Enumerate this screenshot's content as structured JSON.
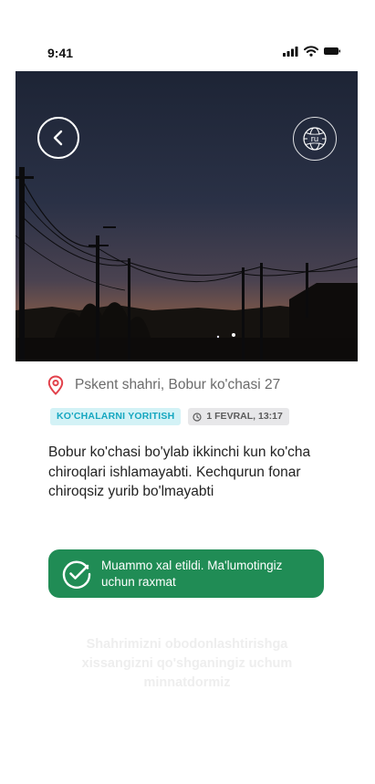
{
  "status_bar": {
    "time": "9:41",
    "icons": [
      "signal-icon",
      "wifi-icon",
      "battery-icon"
    ]
  },
  "hero": {
    "back_icon": "chevron-left-icon",
    "language_icon": "globe-icon",
    "language_code": "ru"
  },
  "report": {
    "location_icon": "map-pin-icon",
    "location": "Pskent shahri, Bobur ko'chasi 27",
    "category": "KO'CHALARNI YORITISH",
    "date_icon": "clock-icon",
    "date": "1 FEVRAL, 13:17",
    "description": "Bobur ko'chasi bo'ylab ikkinchi kun ko'cha chiroqlari ishlamayabti. Kechqurun fonar chiroqsiz yurib bo'lmayabti"
  },
  "resolution": {
    "icon": "check-circle-icon",
    "message": "Muammo xal etildi. Ma'lumotingiz uchun raxmat"
  },
  "footer": {
    "thanks": "Shahrimizni obodonlashtirishga xissangizni qo'shganingiz uchum minnatdormiz"
  },
  "colors": {
    "accent_red": "#e2414b",
    "category_bg": "#d3f2f6",
    "category_text": "#16a7c0",
    "success_green": "#208c55"
  }
}
